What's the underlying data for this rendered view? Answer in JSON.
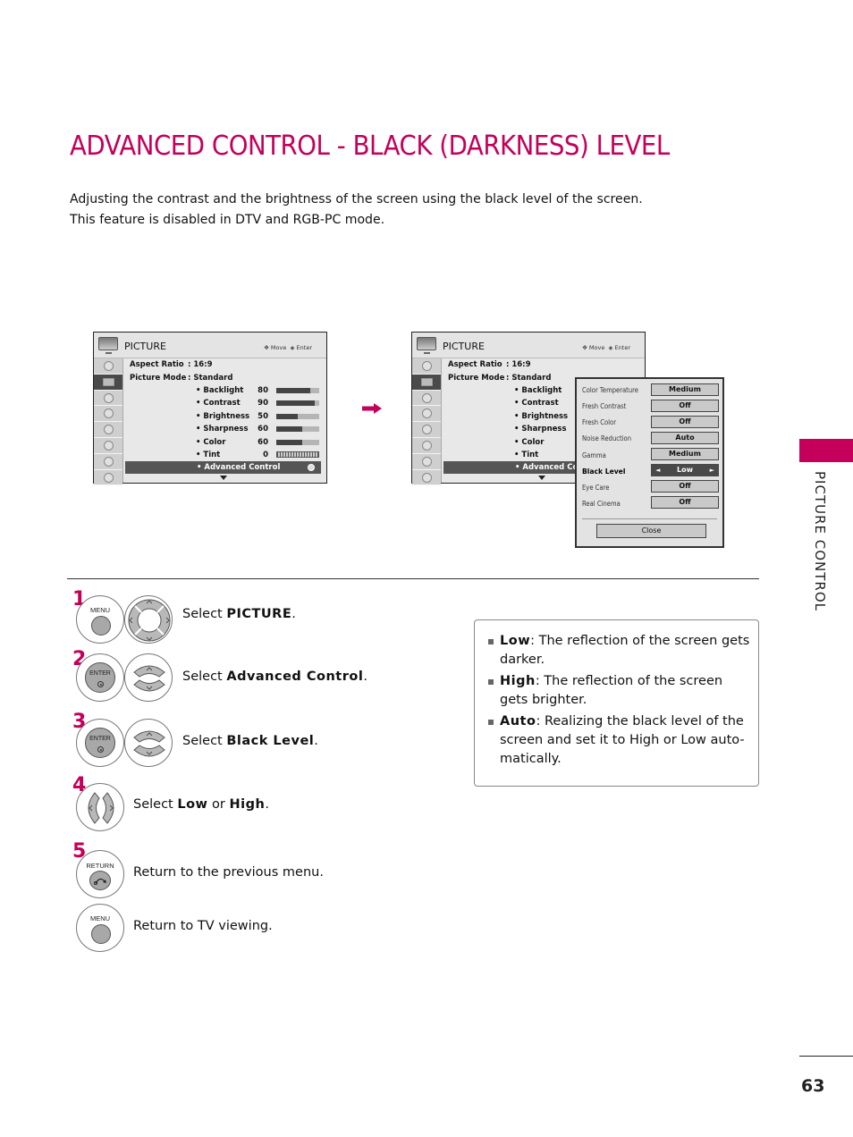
{
  "page": {
    "title": "ADVANCED CONTROL - BLACK (DARKNESS) LEVEL",
    "intro_lines": [
      "Adjusting the contrast and the brightness of the screen using the black level of the screen.",
      "This feature is disabled in DTV and RGB-PC mode."
    ],
    "section_label": "PICTURE CONTROL",
    "page_number": "63",
    "accent_color": "#c4005a"
  },
  "menu_left": {
    "title": "PICTURE",
    "hint_move": "Move",
    "hint_enter": "Enter",
    "aspect_ratio_label": "Aspect Ratio",
    "aspect_ratio_value": ": 16:9",
    "picture_mode_label": "Picture Mode",
    "picture_mode_value": ": Standard",
    "settings": [
      {
        "label": "• Backlight",
        "value": "80",
        "level": 80
      },
      {
        "label": "• Contrast",
        "value": "90",
        "level": 90
      },
      {
        "label": "• Brightness",
        "value": "50",
        "level": 50
      },
      {
        "label": "• Sharpness",
        "value": "60",
        "level": 60
      },
      {
        "label": "• Color",
        "value": "60",
        "level": 60
      },
      {
        "label": "• Tint",
        "value": "0",
        "level": 0
      }
    ],
    "selected_item": "• Advanced Control",
    "nav_icons": [
      "audio-icon",
      "picture-icon",
      "setup-icon",
      "time-icon",
      "option-icon",
      "lock-icon",
      "input-icon",
      "usb-icon"
    ]
  },
  "menu_right": {
    "title": "PICTURE",
    "hint_move": "Move",
    "hint_enter": "Enter",
    "aspect_ratio_label": "Aspect Ratio",
    "aspect_ratio_value": ": 16:9",
    "picture_mode_label": "Picture Mode",
    "picture_mode_value": ": Standard",
    "settings": [
      "• Backlight",
      "• Contrast",
      "• Brightness",
      "• Sharpness",
      "• Color",
      "• Tint"
    ],
    "selected_item": "• Advanced Co"
  },
  "popup": {
    "rows": [
      {
        "label": "Color Temperature",
        "value": "Medium"
      },
      {
        "label": "Fresh Contrast",
        "value": "Off"
      },
      {
        "label": "Fresh Color",
        "value": "Off"
      },
      {
        "label": "Noise Reduction",
        "value": "Auto"
      },
      {
        "label": "Gamma",
        "value": "Medium"
      },
      {
        "label": "Black Level",
        "value": "Low",
        "active": true
      },
      {
        "label": "Eye Care",
        "value": "Off"
      },
      {
        "label": "Real Cinema",
        "value": "Off"
      }
    ],
    "left_arrow": "◄",
    "right_arrow": "►",
    "close_label": "Close"
  },
  "steps": [
    {
      "number": "1",
      "button": "MENU",
      "prefix": "Select ",
      "bold": "PICTURE",
      "suffix": "."
    },
    {
      "number": "2",
      "button": "ENTER",
      "prefix": "Select ",
      "bold": "Advanced Control",
      "suffix": "."
    },
    {
      "number": "3",
      "button": "ENTER",
      "prefix": "Select ",
      "bold": "Black Level",
      "suffix": "."
    },
    {
      "number": "4",
      "prefix": "Select ",
      "bold": "Low",
      "middle": " or ",
      "bold2": "High",
      "suffix": "."
    },
    {
      "number": "5",
      "button": "RETURN",
      "text": "Return to the previous menu."
    },
    {
      "button": "MENU",
      "text": "Return to TV viewing."
    }
  ],
  "info": [
    {
      "term": "Low",
      "desc": ": The reflection of the screen gets darker."
    },
    {
      "term": "High",
      "desc": ": The reflection of the screen gets brighter."
    },
    {
      "term": "Auto",
      "desc": ": Realizing the black level of the screen and set it to High or Low auto-matically."
    }
  ]
}
